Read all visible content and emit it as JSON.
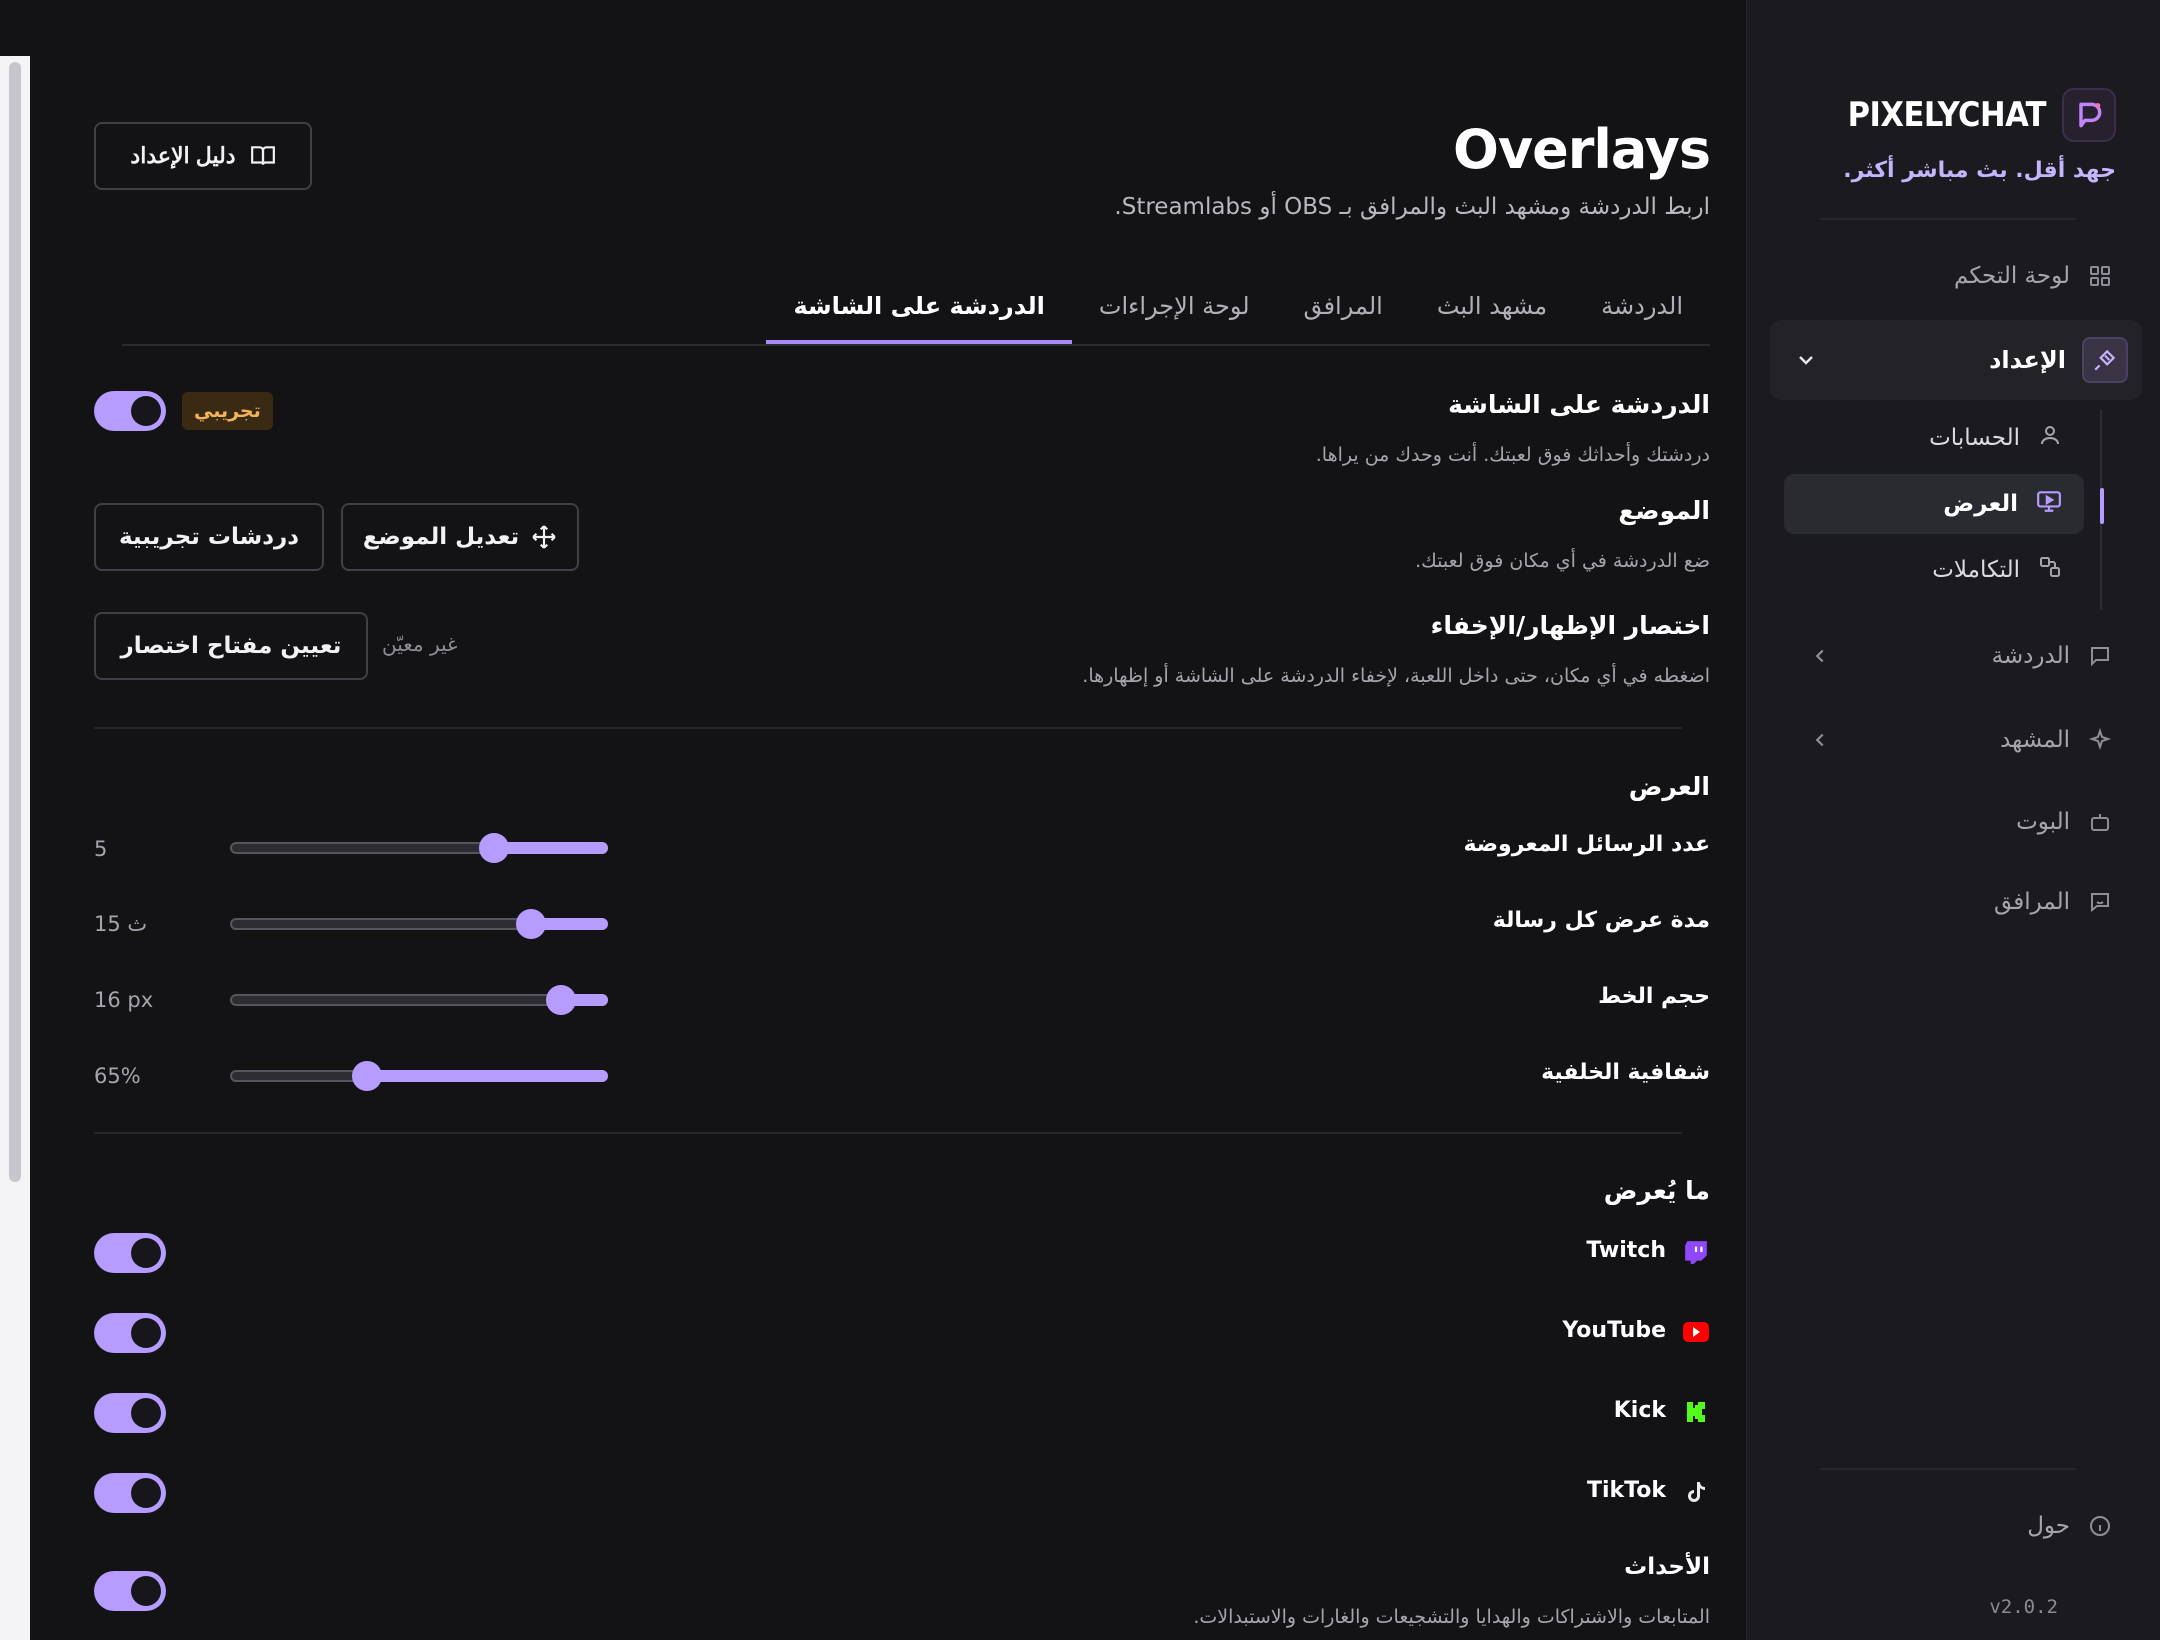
{
  "brand": {
    "name": "PIXELYCHAT",
    "tagline": "جهد أقل. بث مباشر أكثر."
  },
  "sidebar": {
    "dashboard": "لوحة التحكم",
    "setup": "الإعداد",
    "setup_items": {
      "accounts": "الحسابات",
      "display": "العرض",
      "integrations": "التكاملات"
    },
    "chat": "الدردشة",
    "scene": "المشهد",
    "bot": "البوت",
    "companion": "المرافق",
    "about": "حول",
    "version": "v2.0.2"
  },
  "header": {
    "title": "Overlays",
    "subtitle": "اربط الدردشة ومشهد البث والمرافق بـ OBS أو Streamlabs.",
    "setup_guide": "دليل الإعداد"
  },
  "tabs": [
    "الدردشة على الشاشة",
    "لوحة الإجراءات",
    "المرافق",
    "مشهد البث",
    "الدردشة"
  ],
  "onscreen": {
    "title": "الدردشة على الشاشة",
    "desc": "دردشتك وأحداثك فوق لعبتك. أنت وحدك من يراها.",
    "badge": "تجريبي",
    "position_title": "الموضع",
    "position_desc": "ضع الدردشة في أي مكان فوق لعبتك.",
    "edit_position": "تعديل الموضع",
    "test_chats": "دردشات تجريبية",
    "shortcut_title": "اختصار الإظهار/الإخفاء",
    "shortcut_desc": "اضغطه في أي مكان، حتى داخل اللعبة، لإخفاء الدردشة على الشاشة أو إظهارها.",
    "shortcut_state": "غير معيّن",
    "set_shortcut": "تعيين مفتاح اختصار"
  },
  "display": {
    "title": "العرض",
    "sliders": [
      {
        "label": "عدد الرسائل المعروضة",
        "value_text": "5",
        "fraction": 0.7
      },
      {
        "label": "مدة عرض كل رسالة",
        "value_text": "15 ث",
        "fraction": 0.8
      },
      {
        "label": "حجم الخط",
        "value_text": "16 px",
        "fraction": 0.88
      },
      {
        "label": "شفافية الخلفية",
        "value_text": "65%",
        "fraction": 0.36
      }
    ]
  },
  "shown": {
    "title": "ما يُعرض",
    "sources": [
      {
        "label": "Twitch",
        "icon": "twitch-icon",
        "color": "#9146ff",
        "enabled": true
      },
      {
        "label": "YouTube",
        "icon": "youtube-icon",
        "color": "#ff0000",
        "enabled": true
      },
      {
        "label": "Kick",
        "icon": "kick-icon",
        "color": "#53fc18",
        "enabled": true
      },
      {
        "label": "TikTok",
        "icon": "tiktok-icon",
        "color": "#ffffff",
        "enabled": true
      }
    ],
    "events_title": "الأحداث",
    "events_desc": "المتابعات والاشتراكات والهدايا والتشجيعات والغارات والاستبدالات.",
    "events_enabled": true
  },
  "colors": {
    "accent": "#b79cff",
    "tagline": "#c4b5fd",
    "badge": "#f2b35a"
  }
}
